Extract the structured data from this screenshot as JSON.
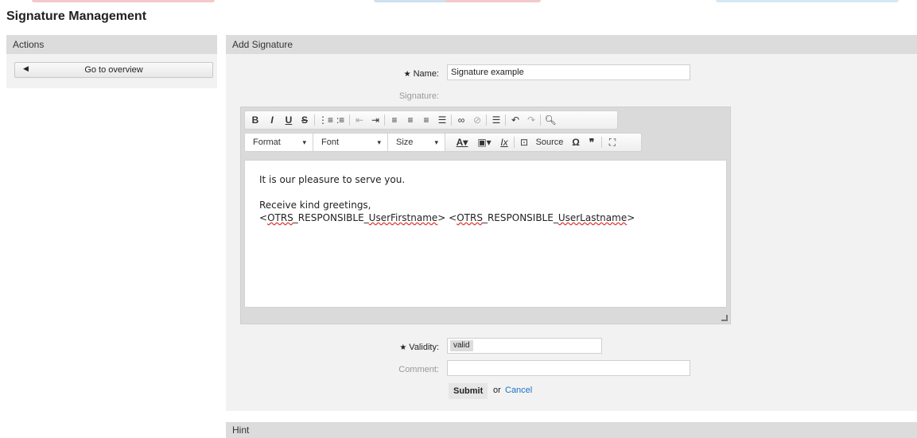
{
  "page": {
    "title": "Signature Management"
  },
  "sidebar": {
    "header": "Actions",
    "overview_button": "Go to overview"
  },
  "form": {
    "header": "Add Signature",
    "name_label": "Name:",
    "name_value": "Signature example",
    "signature_label": "Signature:",
    "validity_label": "Validity:",
    "validity_value": "valid",
    "comment_label": "Comment:",
    "comment_value": "",
    "submit_label": "Submit",
    "or_text": "or",
    "cancel_label": "Cancel"
  },
  "editor": {
    "format_label": "Format",
    "font_label": "Font",
    "size_label": "Size",
    "source_label": "Source",
    "line1": "It is our pleasure to serve you.",
    "line2": "Receive kind greetings,",
    "line3_a": "<",
    "line3_b": "OTRS",
    "line3_c": "_RESPONSIBLE_",
    "line3_d": "UserFirstname",
    "line3_e": "> <",
    "line3_f": "OTRS",
    "line3_g": "_RESPONSIBLE_",
    "line3_h": "UserLastname",
    "line3_i": ">"
  },
  "hint": {
    "header": "Hint"
  },
  "colors": {
    "accent": "#1a73c6",
    "panel": "#f2f2f2",
    "header": "#dcdcdc"
  }
}
